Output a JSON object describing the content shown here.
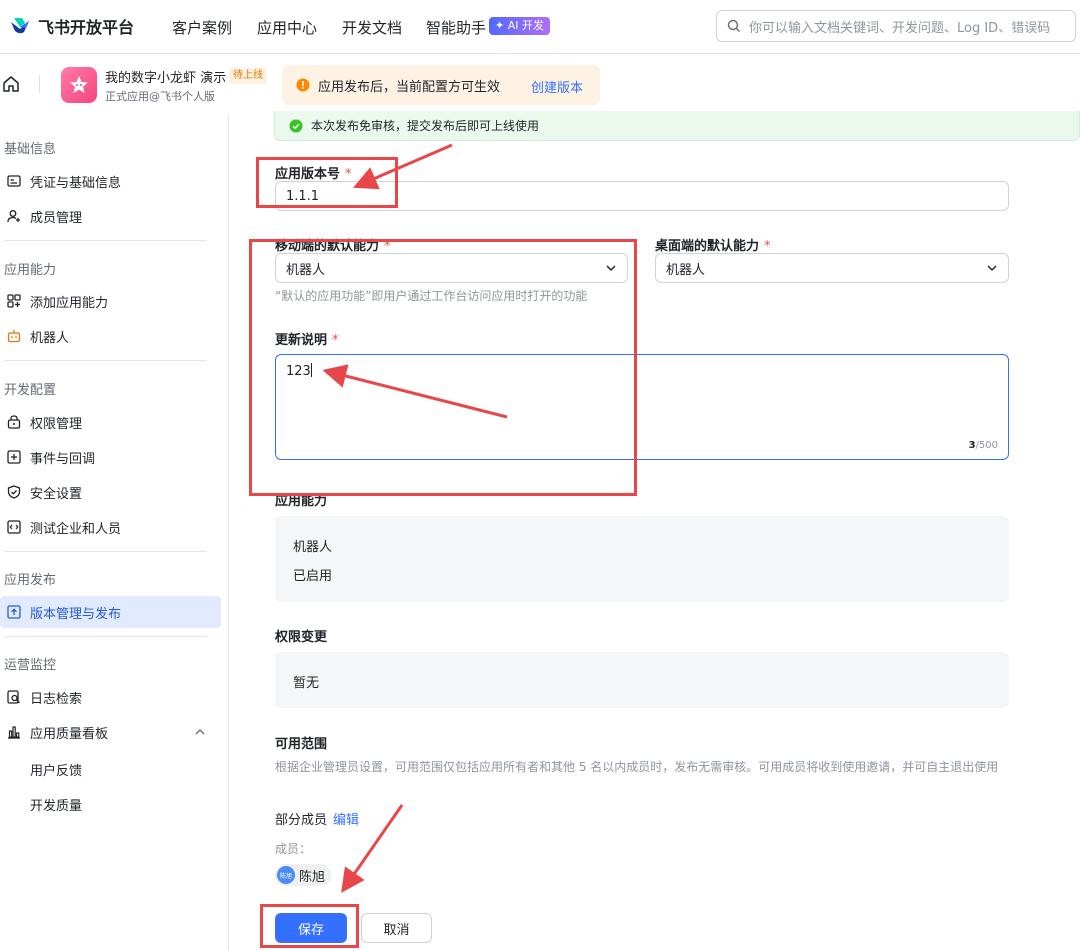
{
  "topnav": {
    "brand": "飞书开放平台",
    "items": [
      "客户案例",
      "应用中心",
      "开发文档",
      "智能助手"
    ],
    "ai_badge": "AI 开发",
    "search_placeholder": "你可以输入文档关键词、开发问题、Log ID、错误码"
  },
  "app": {
    "name": "我的数字小龙虾 演示",
    "status": "待上线",
    "subtitle": "正式应用@飞书个人版"
  },
  "notice": {
    "text": "应用发布后，当前配置方可生效",
    "link": "创建版本"
  },
  "sidebar": {
    "groups": [
      {
        "title": "基础信息",
        "items": [
          "凭证与基础信息",
          "成员管理"
        ]
      },
      {
        "title": "应用能力",
        "items": [
          "添加应用能力",
          "机器人"
        ]
      },
      {
        "title": "开发配置",
        "items": [
          "权限管理",
          "事件与回调",
          "安全设置",
          "测试企业和人员"
        ]
      },
      {
        "title": "应用发布",
        "items": [
          "版本管理与发布"
        ]
      },
      {
        "title": "运营监控",
        "items": [
          "日志检索",
          "应用质量看板"
        ],
        "subitems": [
          "用户反馈",
          "开发质量"
        ]
      }
    ]
  },
  "form": {
    "success": "本次发布免审核，提交发布后即可上线使用",
    "version_label": "应用版本号",
    "version_value": "1.1.1",
    "mobile_label": "移动端的默认能力",
    "mobile_value": "机器人",
    "desktop_label": "桌面端的默认能力",
    "desktop_value": "机器人",
    "default_hint": "“默认的应用功能”即用户通过工作台访问应用时打开的功能",
    "notes_label": "更新说明",
    "notes_value": "123",
    "notes_count": "3",
    "notes_max": "/500",
    "ability_label": "应用能力",
    "ability_name": "机器人",
    "ability_status": "已启用",
    "perm_label": "权限变更",
    "perm_value": "暂无",
    "scope_label": "可用范围",
    "scope_desc": "根据企业管理员设置，可用范围仅包括应用所有者和其他 5 名以内成员时，发布无需审核。可用成员将收到使用邀请，并可自主退出使用",
    "scope_value": "部分成员",
    "scope_edit": "编辑",
    "members_label": "成员：",
    "member_avatar": "陈旭",
    "member_name": "陈旭",
    "save": "保存",
    "cancel": "取消"
  },
  "colors": {
    "primary": "#3370ff",
    "annotation": "#e8474a",
    "success_bg": "#eaf8ee",
    "notice_bg": "#fdf2e3"
  }
}
